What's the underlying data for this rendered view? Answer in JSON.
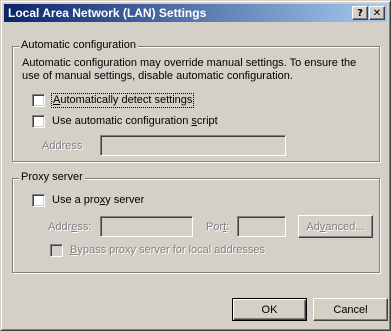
{
  "window": {
    "title": "Local Area Network (LAN) Settings",
    "help_label": "?",
    "close_label": "✕"
  },
  "automatic": {
    "group_label": "Automatic configuration",
    "description": "Automatic configuration may override manual settings.  To ensure the use of manual settings, disable automatic configuration.",
    "detect": {
      "prefix": "",
      "mnemonic": "A",
      "suffix": "utomatically detect settings",
      "checked": false
    },
    "script": {
      "prefix": "Use automatic configuration ",
      "mnemonic": "s",
      "suffix": "cript",
      "checked": false
    },
    "address_label": "Address",
    "address_value": ""
  },
  "proxy": {
    "group_label": "Proxy server",
    "use_proxy": {
      "prefix": "Use a pro",
      "mnemonic": "x",
      "suffix": "y server",
      "checked": false
    },
    "address_prefix": "Addr",
    "address_mnemonic": "e",
    "address_suffix": "ss:",
    "address_value": "",
    "port_prefix": "Por",
    "port_mnemonic": "t",
    "port_suffix": ":",
    "port_value": "",
    "advanced_prefix": "Ad",
    "advanced_mnemonic": "v",
    "advanced_suffix": "anced...",
    "bypass": {
      "prefix": "",
      "mnemonic": "B",
      "suffix": "ypass proxy server for local addresses",
      "checked": false
    }
  },
  "buttons": {
    "ok": "OK",
    "cancel": "Cancel"
  }
}
